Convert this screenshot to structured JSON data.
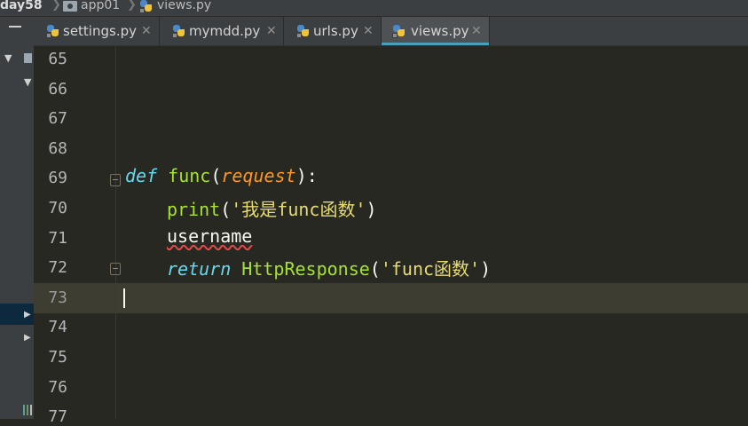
{
  "breadcrumb": {
    "items": [
      {
        "label": "day58",
        "icon": "folder-icon"
      },
      {
        "label": "app01",
        "icon": "folder-icon"
      },
      {
        "label": "views.py",
        "icon": "python-file-icon"
      }
    ]
  },
  "tabs": [
    {
      "label": "settings.py",
      "icon": "python-file-icon",
      "active": false
    },
    {
      "label": "mymdd.py",
      "icon": "python-file-icon",
      "active": false
    },
    {
      "label": "urls.py",
      "icon": "python-file-icon",
      "active": false
    },
    {
      "label": "views.py",
      "icon": "python-file-icon",
      "active": true
    }
  ],
  "tab_close_glyph": "✕",
  "editor": {
    "current_line": "73",
    "lines": [
      {
        "number": "65",
        "tokens": []
      },
      {
        "number": "66",
        "tokens": []
      },
      {
        "number": "67",
        "tokens": []
      },
      {
        "number": "68",
        "tokens": []
      },
      {
        "number": "69",
        "tokens": [
          {
            "text": "def",
            "kind": "keyword"
          },
          {
            "text": " ",
            "kind": "plain"
          },
          {
            "text": "func",
            "kind": "function"
          },
          {
            "text": "(",
            "kind": "plain"
          },
          {
            "text": "request",
            "kind": "param"
          },
          {
            "text": "):",
            "kind": "plain"
          }
        ]
      },
      {
        "number": "70",
        "tokens": [
          {
            "text": "print",
            "kind": "function"
          },
          {
            "text": "(",
            "kind": "plain"
          },
          {
            "text": "'我是func函数'",
            "kind": "string"
          },
          {
            "text": ")",
            "kind": "plain"
          }
        ]
      },
      {
        "number": "71",
        "tokens": [
          {
            "text": "username",
            "kind": "plain-underlined"
          }
        ]
      },
      {
        "number": "72",
        "tokens": [
          {
            "text": "return",
            "kind": "keyword"
          },
          {
            "text": " ",
            "kind": "plain"
          },
          {
            "text": "HttpResponse",
            "kind": "function"
          },
          {
            "text": "(",
            "kind": "plain"
          },
          {
            "text": "'func函数'",
            "kind": "string"
          },
          {
            "text": ")",
            "kind": "plain"
          }
        ]
      },
      {
        "number": "73",
        "tokens": []
      },
      {
        "number": "74",
        "tokens": []
      },
      {
        "number": "75",
        "tokens": []
      },
      {
        "number": "76",
        "tokens": []
      },
      {
        "number": "77",
        "tokens": []
      }
    ]
  },
  "colors": {
    "editor_background": "#272822",
    "keyword": "#66d9ef",
    "function": "#a6e22e",
    "param": "#fd971f",
    "string": "#e6db74",
    "active_tab_underline": "#4a9eb8"
  }
}
